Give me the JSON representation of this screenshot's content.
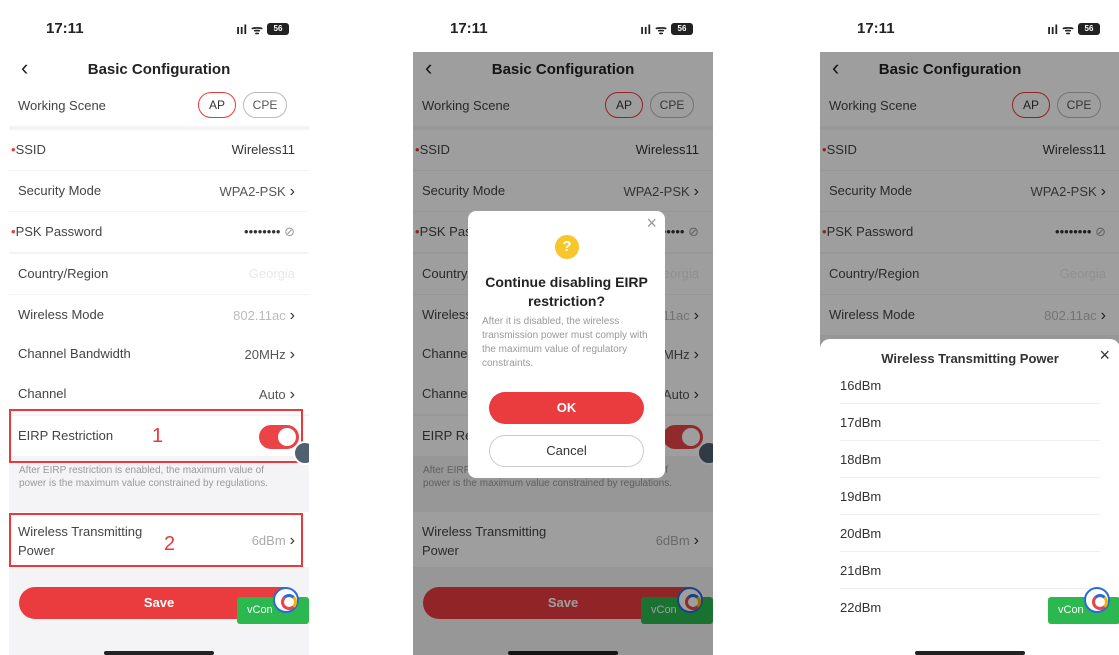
{
  "status": {
    "time": "17:11",
    "signal": "ııl",
    "wifi": "ᯤ",
    "battery": "56"
  },
  "page": {
    "title": "Basic Configuration",
    "back_glyph": "‹"
  },
  "fields": {
    "working_scene": {
      "label": "Working Scene",
      "options": [
        "AP",
        "CPE"
      ],
      "selected": "AP"
    },
    "ssid": {
      "required_mark": "•",
      "label": "SSID",
      "value": "Wireless11"
    },
    "security_mode": {
      "label": "Security Mode",
      "value": "WPA2-PSK"
    },
    "psk_password": {
      "required_mark": "•",
      "label": "PSK Password",
      "value": "••••••••",
      "eye_glyph": "⊘"
    },
    "country": {
      "label": "Country/Region",
      "value": "Georgia"
    },
    "wireless_mode": {
      "label": "Wireless Mode",
      "value": "802.11ac"
    },
    "channel_bandwidth": {
      "label": "Channel Bandwidth",
      "value": "20MHz"
    },
    "channel": {
      "label": "Channel",
      "value": "Auto"
    },
    "eirp": {
      "label": "EIRP Restriction",
      "enabled": true
    },
    "eirp_hint": "After EIRP restriction is enabled, the maximum value of power is the maximum value constrained by regulations.",
    "tx_power": {
      "label": "Wireless Transmitting Power",
      "value": "6dBm"
    }
  },
  "chevron": "›",
  "save_label": "Save",
  "vconsole_label": "vCon",
  "callouts": {
    "one": "1",
    "two": "2"
  },
  "dialog": {
    "icon": "?",
    "title": "Continue disabling EIRP restriction?",
    "text": "After it is disabled, the wireless transmission power must comply with the maximum value of regulatory constraints.",
    "ok_label": "OK",
    "cancel_label": "Cancel",
    "close_glyph": "×"
  },
  "sheet": {
    "title": "Wireless Transmitting Power",
    "close_glyph": "×",
    "options": [
      "16dBm",
      "17dBm",
      "18dBm",
      "19dBm",
      "20dBm",
      "21dBm",
      "22dBm"
    ]
  },
  "colors": {
    "accent": "#ea3b3e",
    "toggle_on": "#ea4448",
    "vconsole": "#2bb94f",
    "warning": "#f7c62a"
  }
}
